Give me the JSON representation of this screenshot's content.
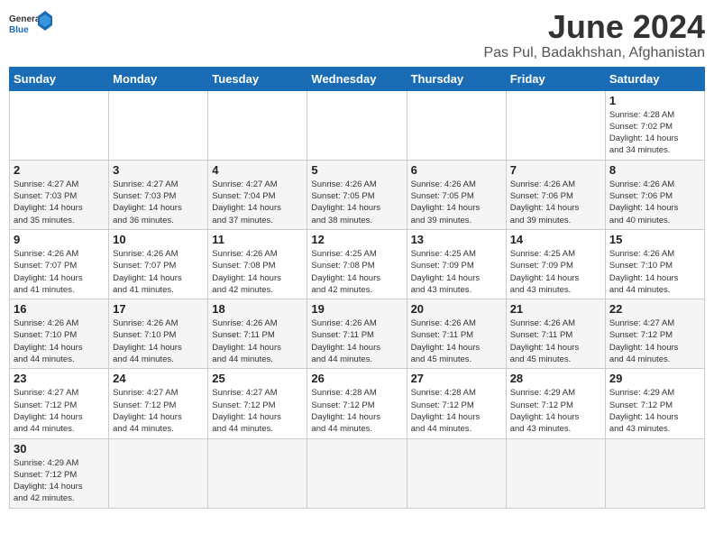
{
  "header": {
    "logo_general": "General",
    "logo_blue": "Blue",
    "title": "June 2024",
    "subtitle": "Pas Pul, Badakhshan, Afghanistan"
  },
  "weekdays": [
    "Sunday",
    "Monday",
    "Tuesday",
    "Wednesday",
    "Thursday",
    "Friday",
    "Saturday"
  ],
  "weeks": [
    [
      {
        "day": "",
        "info": ""
      },
      {
        "day": "",
        "info": ""
      },
      {
        "day": "",
        "info": ""
      },
      {
        "day": "",
        "info": ""
      },
      {
        "day": "",
        "info": ""
      },
      {
        "day": "",
        "info": ""
      },
      {
        "day": "1",
        "info": "Sunrise: 4:28 AM\nSunset: 7:02 PM\nDaylight: 14 hours\nand 34 minutes."
      }
    ],
    [
      {
        "day": "2",
        "info": "Sunrise: 4:27 AM\nSunset: 7:03 PM\nDaylight: 14 hours\nand 35 minutes."
      },
      {
        "day": "3",
        "info": "Sunrise: 4:27 AM\nSunset: 7:03 PM\nDaylight: 14 hours\nand 36 minutes."
      },
      {
        "day": "4",
        "info": "Sunrise: 4:27 AM\nSunset: 7:04 PM\nDaylight: 14 hours\nand 37 minutes."
      },
      {
        "day": "5",
        "info": "Sunrise: 4:26 AM\nSunset: 7:05 PM\nDaylight: 14 hours\nand 38 minutes."
      },
      {
        "day": "6",
        "info": "Sunrise: 4:26 AM\nSunset: 7:05 PM\nDaylight: 14 hours\nand 39 minutes."
      },
      {
        "day": "7",
        "info": "Sunrise: 4:26 AM\nSunset: 7:06 PM\nDaylight: 14 hours\nand 39 minutes."
      },
      {
        "day": "8",
        "info": "Sunrise: 4:26 AM\nSunset: 7:06 PM\nDaylight: 14 hours\nand 40 minutes."
      }
    ],
    [
      {
        "day": "9",
        "info": "Sunrise: 4:26 AM\nSunset: 7:07 PM\nDaylight: 14 hours\nand 41 minutes."
      },
      {
        "day": "10",
        "info": "Sunrise: 4:26 AM\nSunset: 7:07 PM\nDaylight: 14 hours\nand 41 minutes."
      },
      {
        "day": "11",
        "info": "Sunrise: 4:26 AM\nSunset: 7:08 PM\nDaylight: 14 hours\nand 42 minutes."
      },
      {
        "day": "12",
        "info": "Sunrise: 4:25 AM\nSunset: 7:08 PM\nDaylight: 14 hours\nand 42 minutes."
      },
      {
        "day": "13",
        "info": "Sunrise: 4:25 AM\nSunset: 7:09 PM\nDaylight: 14 hours\nand 43 minutes."
      },
      {
        "day": "14",
        "info": "Sunrise: 4:25 AM\nSunset: 7:09 PM\nDaylight: 14 hours\nand 43 minutes."
      },
      {
        "day": "15",
        "info": "Sunrise: 4:26 AM\nSunset: 7:10 PM\nDaylight: 14 hours\nand 44 minutes."
      }
    ],
    [
      {
        "day": "16",
        "info": "Sunrise: 4:26 AM\nSunset: 7:10 PM\nDaylight: 14 hours\nand 44 minutes."
      },
      {
        "day": "17",
        "info": "Sunrise: 4:26 AM\nSunset: 7:10 PM\nDaylight: 14 hours\nand 44 minutes."
      },
      {
        "day": "18",
        "info": "Sunrise: 4:26 AM\nSunset: 7:11 PM\nDaylight: 14 hours\nand 44 minutes."
      },
      {
        "day": "19",
        "info": "Sunrise: 4:26 AM\nSunset: 7:11 PM\nDaylight: 14 hours\nand 44 minutes."
      },
      {
        "day": "20",
        "info": "Sunrise: 4:26 AM\nSunset: 7:11 PM\nDaylight: 14 hours\nand 45 minutes."
      },
      {
        "day": "21",
        "info": "Sunrise: 4:26 AM\nSunset: 7:11 PM\nDaylight: 14 hours\nand 45 minutes."
      },
      {
        "day": "22",
        "info": "Sunrise: 4:27 AM\nSunset: 7:12 PM\nDaylight: 14 hours\nand 44 minutes."
      }
    ],
    [
      {
        "day": "23",
        "info": "Sunrise: 4:27 AM\nSunset: 7:12 PM\nDaylight: 14 hours\nand 44 minutes."
      },
      {
        "day": "24",
        "info": "Sunrise: 4:27 AM\nSunset: 7:12 PM\nDaylight: 14 hours\nand 44 minutes."
      },
      {
        "day": "25",
        "info": "Sunrise: 4:27 AM\nSunset: 7:12 PM\nDaylight: 14 hours\nand 44 minutes."
      },
      {
        "day": "26",
        "info": "Sunrise: 4:28 AM\nSunset: 7:12 PM\nDaylight: 14 hours\nand 44 minutes."
      },
      {
        "day": "27",
        "info": "Sunrise: 4:28 AM\nSunset: 7:12 PM\nDaylight: 14 hours\nand 44 minutes."
      },
      {
        "day": "28",
        "info": "Sunrise: 4:29 AM\nSunset: 7:12 PM\nDaylight: 14 hours\nand 43 minutes."
      },
      {
        "day": "29",
        "info": "Sunrise: 4:29 AM\nSunset: 7:12 PM\nDaylight: 14 hours\nand 43 minutes."
      }
    ],
    [
      {
        "day": "30",
        "info": "Sunrise: 4:29 AM\nSunset: 7:12 PM\nDaylight: 14 hours\nand 42 minutes."
      },
      {
        "day": "",
        "info": ""
      },
      {
        "day": "",
        "info": ""
      },
      {
        "day": "",
        "info": ""
      },
      {
        "day": "",
        "info": ""
      },
      {
        "day": "",
        "info": ""
      },
      {
        "day": "",
        "info": ""
      }
    ]
  ]
}
